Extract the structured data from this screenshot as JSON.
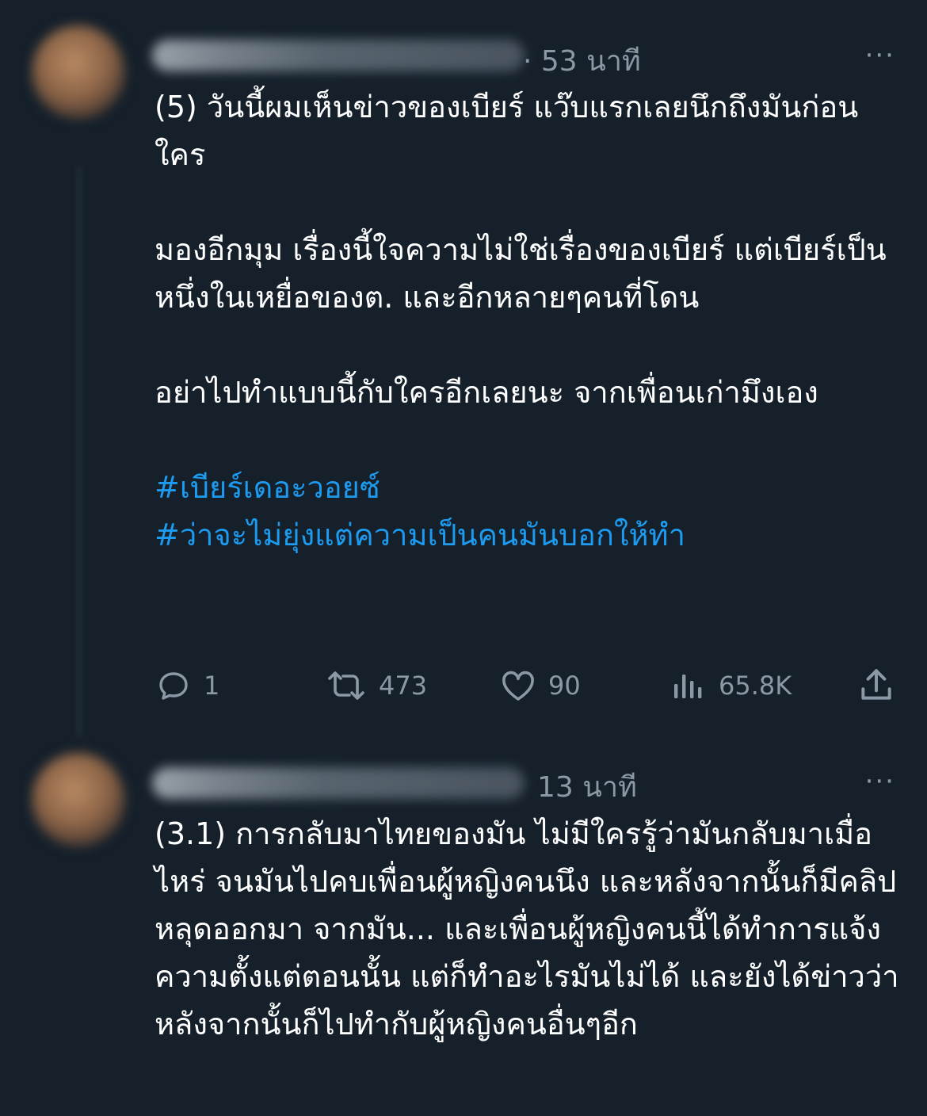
{
  "tweets": [
    {
      "time": "· 53 นาที",
      "more": "···",
      "paragraphs": [
        "(5) วันนี้ผมเห็นข่าวของเบียร์ แว๊บแรกเลยนึกถึงมันก่อนใคร",
        "มองอีกมุม เรื่องนี้ใจความไม่ใช่เรื่องของเบียร์ แต่เบียร์เป็นหนึ่งในเหยื่อของต. และอีกหลายๆคนที่โดน",
        "อย่าไปทำแบบนี้กับใครอีกเลยนะ จากเพื่อนเก่ามึงเอง"
      ],
      "hashtags": [
        "#เบียร์เดอะวอยซ์",
        "#ว่าจะไม่ยุ่งแต่ความเป็นคนมันบอกให้ทำ"
      ],
      "actions": {
        "replies": "1",
        "retweets": "473",
        "likes": "90",
        "views": "65.8K"
      }
    },
    {
      "time": "13 นาที",
      "more": "···",
      "paragraphs": [
        "(3.1) การกลับมาไทยของมัน ไม่มีใครรู้ว่ามันกลับมาเมื่อไหร่ จนมันไปคบเพื่อนผู้หญิงคนนึง และหลังจากนั้นก็มีคลิปหลุดออกมา จากมัน... และเพื่อนผู้หญิงคนนี้ได้ทำการแจ้งความตั้งแต่ตอนนั้น แต่ก็ทำอะไรมันไม่ได้ และยังได้ข่าวว่าหลังจากนั้นก็ไปทำกับผู้หญิงคนอื่นๆอีก"
      ]
    }
  ],
  "icons": {
    "reply": "reply-icon",
    "retweet": "retweet-icon",
    "like": "heart-icon",
    "views": "views-icon",
    "share": "share-icon",
    "more": "more-icon"
  },
  "colors": {
    "background": "#15202b",
    "text": "#ffffff",
    "secondary": "#8b98a5",
    "link": "#1d9bf0"
  }
}
